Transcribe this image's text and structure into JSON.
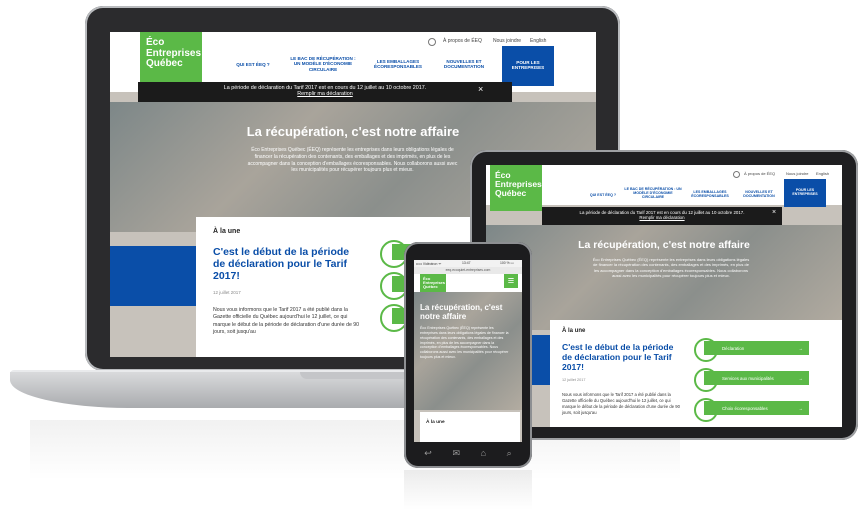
{
  "site": {
    "logo_line1": "Éco",
    "logo_line2": "Entreprises",
    "logo_line3": "Québec",
    "util_links": [
      "À propos de ÉEQ",
      "Nous joindre",
      "English"
    ],
    "nav": [
      "QUI EST ÉEQ ?",
      "LE BAC DE RÉCUPÉRATION : UN MODÈLE D'ÉCONOMIE CIRCULAIRE",
      "LES EMBALLAGES ÉCORESPONSABLES",
      "NOUVELLES ET DOCUMENTATION",
      "POUR LES ENTREPRISES"
    ],
    "banner_text": "La période de déclaration du Tarif 2017 est en cours du 12 juillet au 10 octobre 2017.",
    "banner_link": "Remplir ma déclaration",
    "banner_close": "×",
    "hero_title": "La récupération, c'est notre affaire",
    "hero_text": "Éco Entreprises Québec (ÉEQ) représente les entreprises dans leurs obligations légales de financer la récupération des contenants, des emballages et des imprimés, en plus de les accompagner dans la conception d'emballages écoresponsables. Nous collaborons aussi avec les municipalités pour récupérer toujours plus et mieux.",
    "kicker": "À la une",
    "headline": "C'est le début de la période de déclaration pour le Tarif 2017!",
    "date": "12 juillet 2017",
    "body": "Nous vous informons que le Tarif 2017 a été publié dans la Gazette officielle du Québec aujourd'hui le 12 juillet, ce qui marque le début de la période de déclaration d'une durée de 90 jours, soit jusqu'au",
    "side_buttons": [
      "Déclaration",
      "Services aux municipalités",
      "Choix écoresponsables"
    ],
    "arrow": "→",
    "menu_icon": "≡"
  },
  "phone": {
    "status_left": "••••• Vidéotron ᯤ",
    "status_time": "13:47",
    "status_right": "100 % ▭",
    "url": "eeq.ecoquiet-entreprises.com",
    "hero_title": "La récupération, c'est notre affaire"
  },
  "colors": {
    "green": "#5bb947",
    "blue": "#0a4ea8",
    "banner": "#1b1b1b"
  }
}
